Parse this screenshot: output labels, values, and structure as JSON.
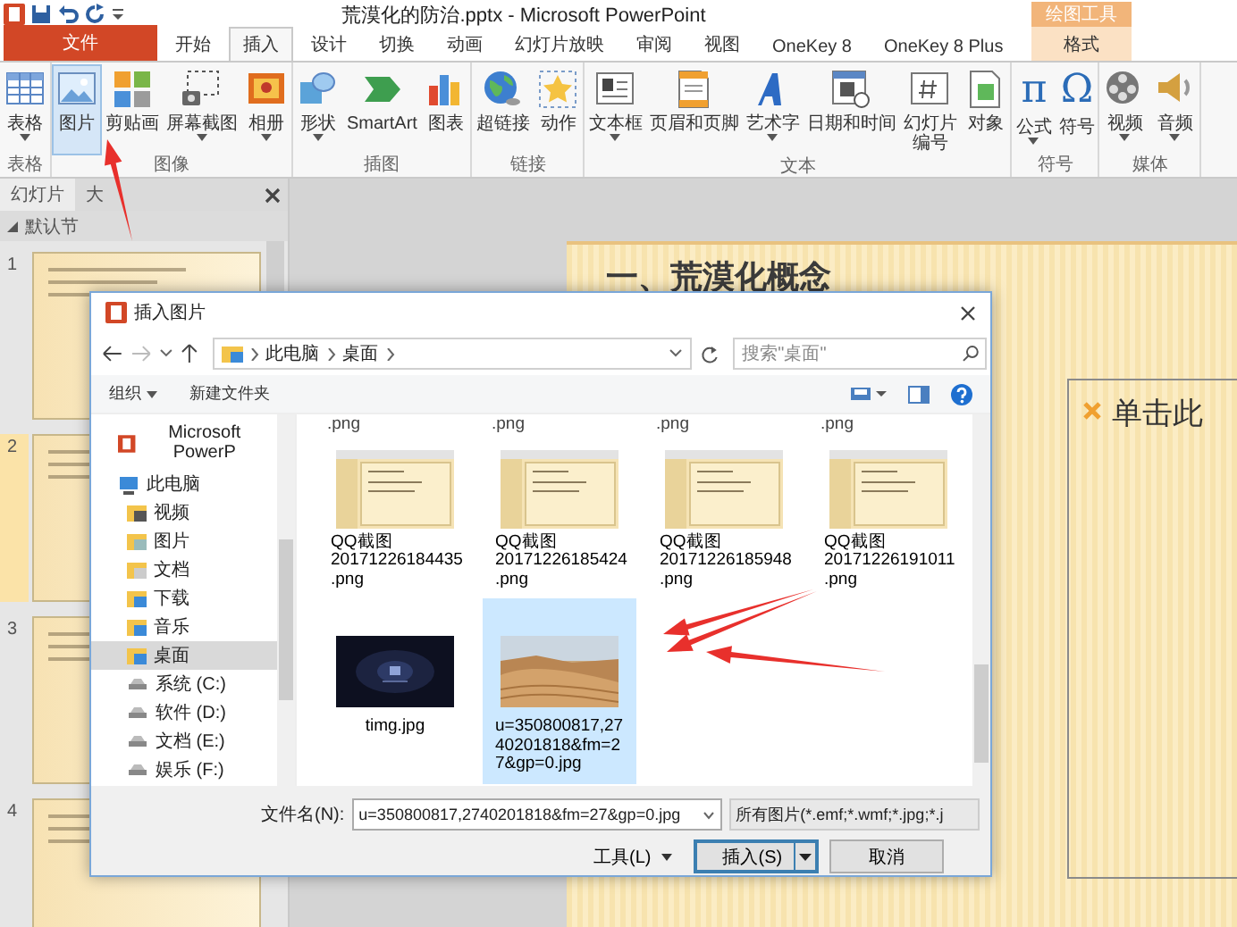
{
  "window": {
    "title": "荒漠化的防治.pptx - Microsoft PowerPoint"
  },
  "ribbon_tabs": [
    {
      "label": "文件",
      "kind": "file",
      "selected": false
    },
    {
      "label": "开始",
      "kind": "tab",
      "selected": false
    },
    {
      "label": "插入",
      "kind": "tab",
      "selected": true
    },
    {
      "label": "设计",
      "kind": "tab",
      "selected": false
    },
    {
      "label": "切换",
      "kind": "tab",
      "selected": false
    },
    {
      "label": "动画",
      "kind": "tab",
      "selected": false
    },
    {
      "label": "幻灯片放映",
      "kind": "tab",
      "selected": false
    },
    {
      "label": "审阅",
      "kind": "tab",
      "selected": false
    },
    {
      "label": "视图",
      "kind": "tab",
      "selected": false
    },
    {
      "label": "OneKey 8",
      "kind": "tab",
      "selected": false
    },
    {
      "label": "OneKey 8 Plus",
      "kind": "tab",
      "selected": false
    },
    {
      "label": "格式",
      "kind": "contextual",
      "context": "绘图工具",
      "selected": false
    }
  ],
  "ribbon_groups": [
    {
      "label": "表格",
      "buttons": [
        {
          "label": "表格",
          "dropdown": true,
          "selected": false
        }
      ]
    },
    {
      "label": "图像",
      "buttons": [
        {
          "label": "图片",
          "dropdown": false,
          "selected": true
        },
        {
          "label": "剪贴画",
          "dropdown": false,
          "selected": false
        },
        {
          "label": "屏幕截图",
          "dropdown": true,
          "selected": false
        },
        {
          "label": "相册",
          "dropdown": true,
          "selected": false
        }
      ]
    },
    {
      "label": "插图",
      "buttons": [
        {
          "label": "形状",
          "dropdown": true,
          "selected": false
        },
        {
          "label": "SmartArt",
          "dropdown": false,
          "selected": false
        },
        {
          "label": "图表",
          "dropdown": false,
          "selected": false
        }
      ]
    },
    {
      "label": "链接",
      "buttons": [
        {
          "label": "超链接",
          "dropdown": false,
          "selected": false
        },
        {
          "label": "动作",
          "dropdown": false,
          "selected": false
        }
      ]
    },
    {
      "label": "文本",
      "buttons": [
        {
          "label": "文本框",
          "dropdown": true,
          "selected": false
        },
        {
          "label": "页眉和页脚",
          "dropdown": false,
          "selected": false
        },
        {
          "label": "艺术字",
          "dropdown": true,
          "selected": false
        },
        {
          "label": "日期和时间",
          "dropdown": false,
          "selected": false
        },
        {
          "label": "幻灯片编号",
          "dropdown": false,
          "selected": false,
          "wrap": true
        },
        {
          "label": "对象",
          "dropdown": false,
          "selected": false
        }
      ]
    },
    {
      "label": "符号",
      "buttons": [
        {
          "label": "公式",
          "dropdown": true,
          "selected": false,
          "glyph": "π"
        },
        {
          "label": "符号",
          "dropdown": false,
          "selected": false,
          "glyph": "Ω"
        }
      ]
    },
    {
      "label": "媒体",
      "buttons": [
        {
          "label": "视频",
          "dropdown": true,
          "selected": false
        },
        {
          "label": "音频",
          "dropdown": true,
          "selected": false
        }
      ]
    }
  ],
  "slide_panel": {
    "tabs": [
      {
        "label": "幻灯片",
        "selected": true
      },
      {
        "label": "大",
        "selected": false
      }
    ],
    "section": "默认节",
    "slides": [
      {
        "number": "1",
        "selected": false
      },
      {
        "number": "2",
        "selected": true
      },
      {
        "number": "3",
        "selected": false
      },
      {
        "number": "4",
        "selected": false
      }
    ]
  },
  "slide": {
    "title": "一、荒漠化概念",
    "placeholder": "单击此"
  },
  "dialog": {
    "title": "插入图片",
    "path": [
      "此电脑",
      "桌面"
    ],
    "search": {
      "placeholder": "搜索\"桌面\""
    },
    "toolbar": {
      "organize": "组织",
      "new_folder": "新建文件夹"
    },
    "navigation": [
      {
        "label": "Microsoft PowerP",
        "selected": false
      },
      {
        "label": "此电脑",
        "selected": false,
        "children": [
          {
            "label": "视频",
            "selected": false
          },
          {
            "label": "图片",
            "selected": false
          },
          {
            "label": "文档",
            "selected": false
          },
          {
            "label": "下载",
            "selected": false
          },
          {
            "label": "音乐",
            "selected": false
          },
          {
            "label": "桌面",
            "selected": true
          },
          {
            "label": "系统 (C:)",
            "selected": false
          },
          {
            "label": "软件 (D:)",
            "selected": false
          },
          {
            "label": "文档 (E:)",
            "selected": false
          },
          {
            "label": "娱乐 (F:)",
            "selected": false
          }
        ]
      }
    ],
    "files": [
      {
        "name": ".png",
        "kind": "partial",
        "selected": false
      },
      {
        "name": ".png",
        "kind": "partial",
        "selected": false
      },
      {
        "name": ".png",
        "kind": "partial",
        "selected": false
      },
      {
        "name": ".png",
        "kind": "partial",
        "selected": false
      },
      {
        "name": "QQ截图\n20171226184435\n.png",
        "kind": "screenshot",
        "selected": false
      },
      {
        "name": "QQ截图\n20171226185424\n.png",
        "kind": "screenshot",
        "selected": false
      },
      {
        "name": "QQ截图\n20171226185948\n.png",
        "kind": "screenshot",
        "selected": false
      },
      {
        "name": "QQ截图\n20171226191011\n.png",
        "kind": "screenshot",
        "selected": false
      },
      {
        "name": "timg.jpg",
        "kind": "dark-picture",
        "selected": false
      },
      {
        "name": "u=350800817,27\n40201818&fm=2\n7&gp=0.jpg",
        "kind": "desert-picture",
        "selected": true
      }
    ],
    "filename_label": "文件名(N):",
    "filename": "u=350800817,2740201818&fm=27&gp=0.jpg",
    "filter": "所有图片(*.emf;*.wmf;*.jpg;*.j",
    "buttons": [
      {
        "label": "工具(L)",
        "kind": "menu"
      },
      {
        "label": "插入(S)",
        "kind": "split"
      },
      {
        "label": "取消",
        "kind": "plain"
      }
    ]
  }
}
